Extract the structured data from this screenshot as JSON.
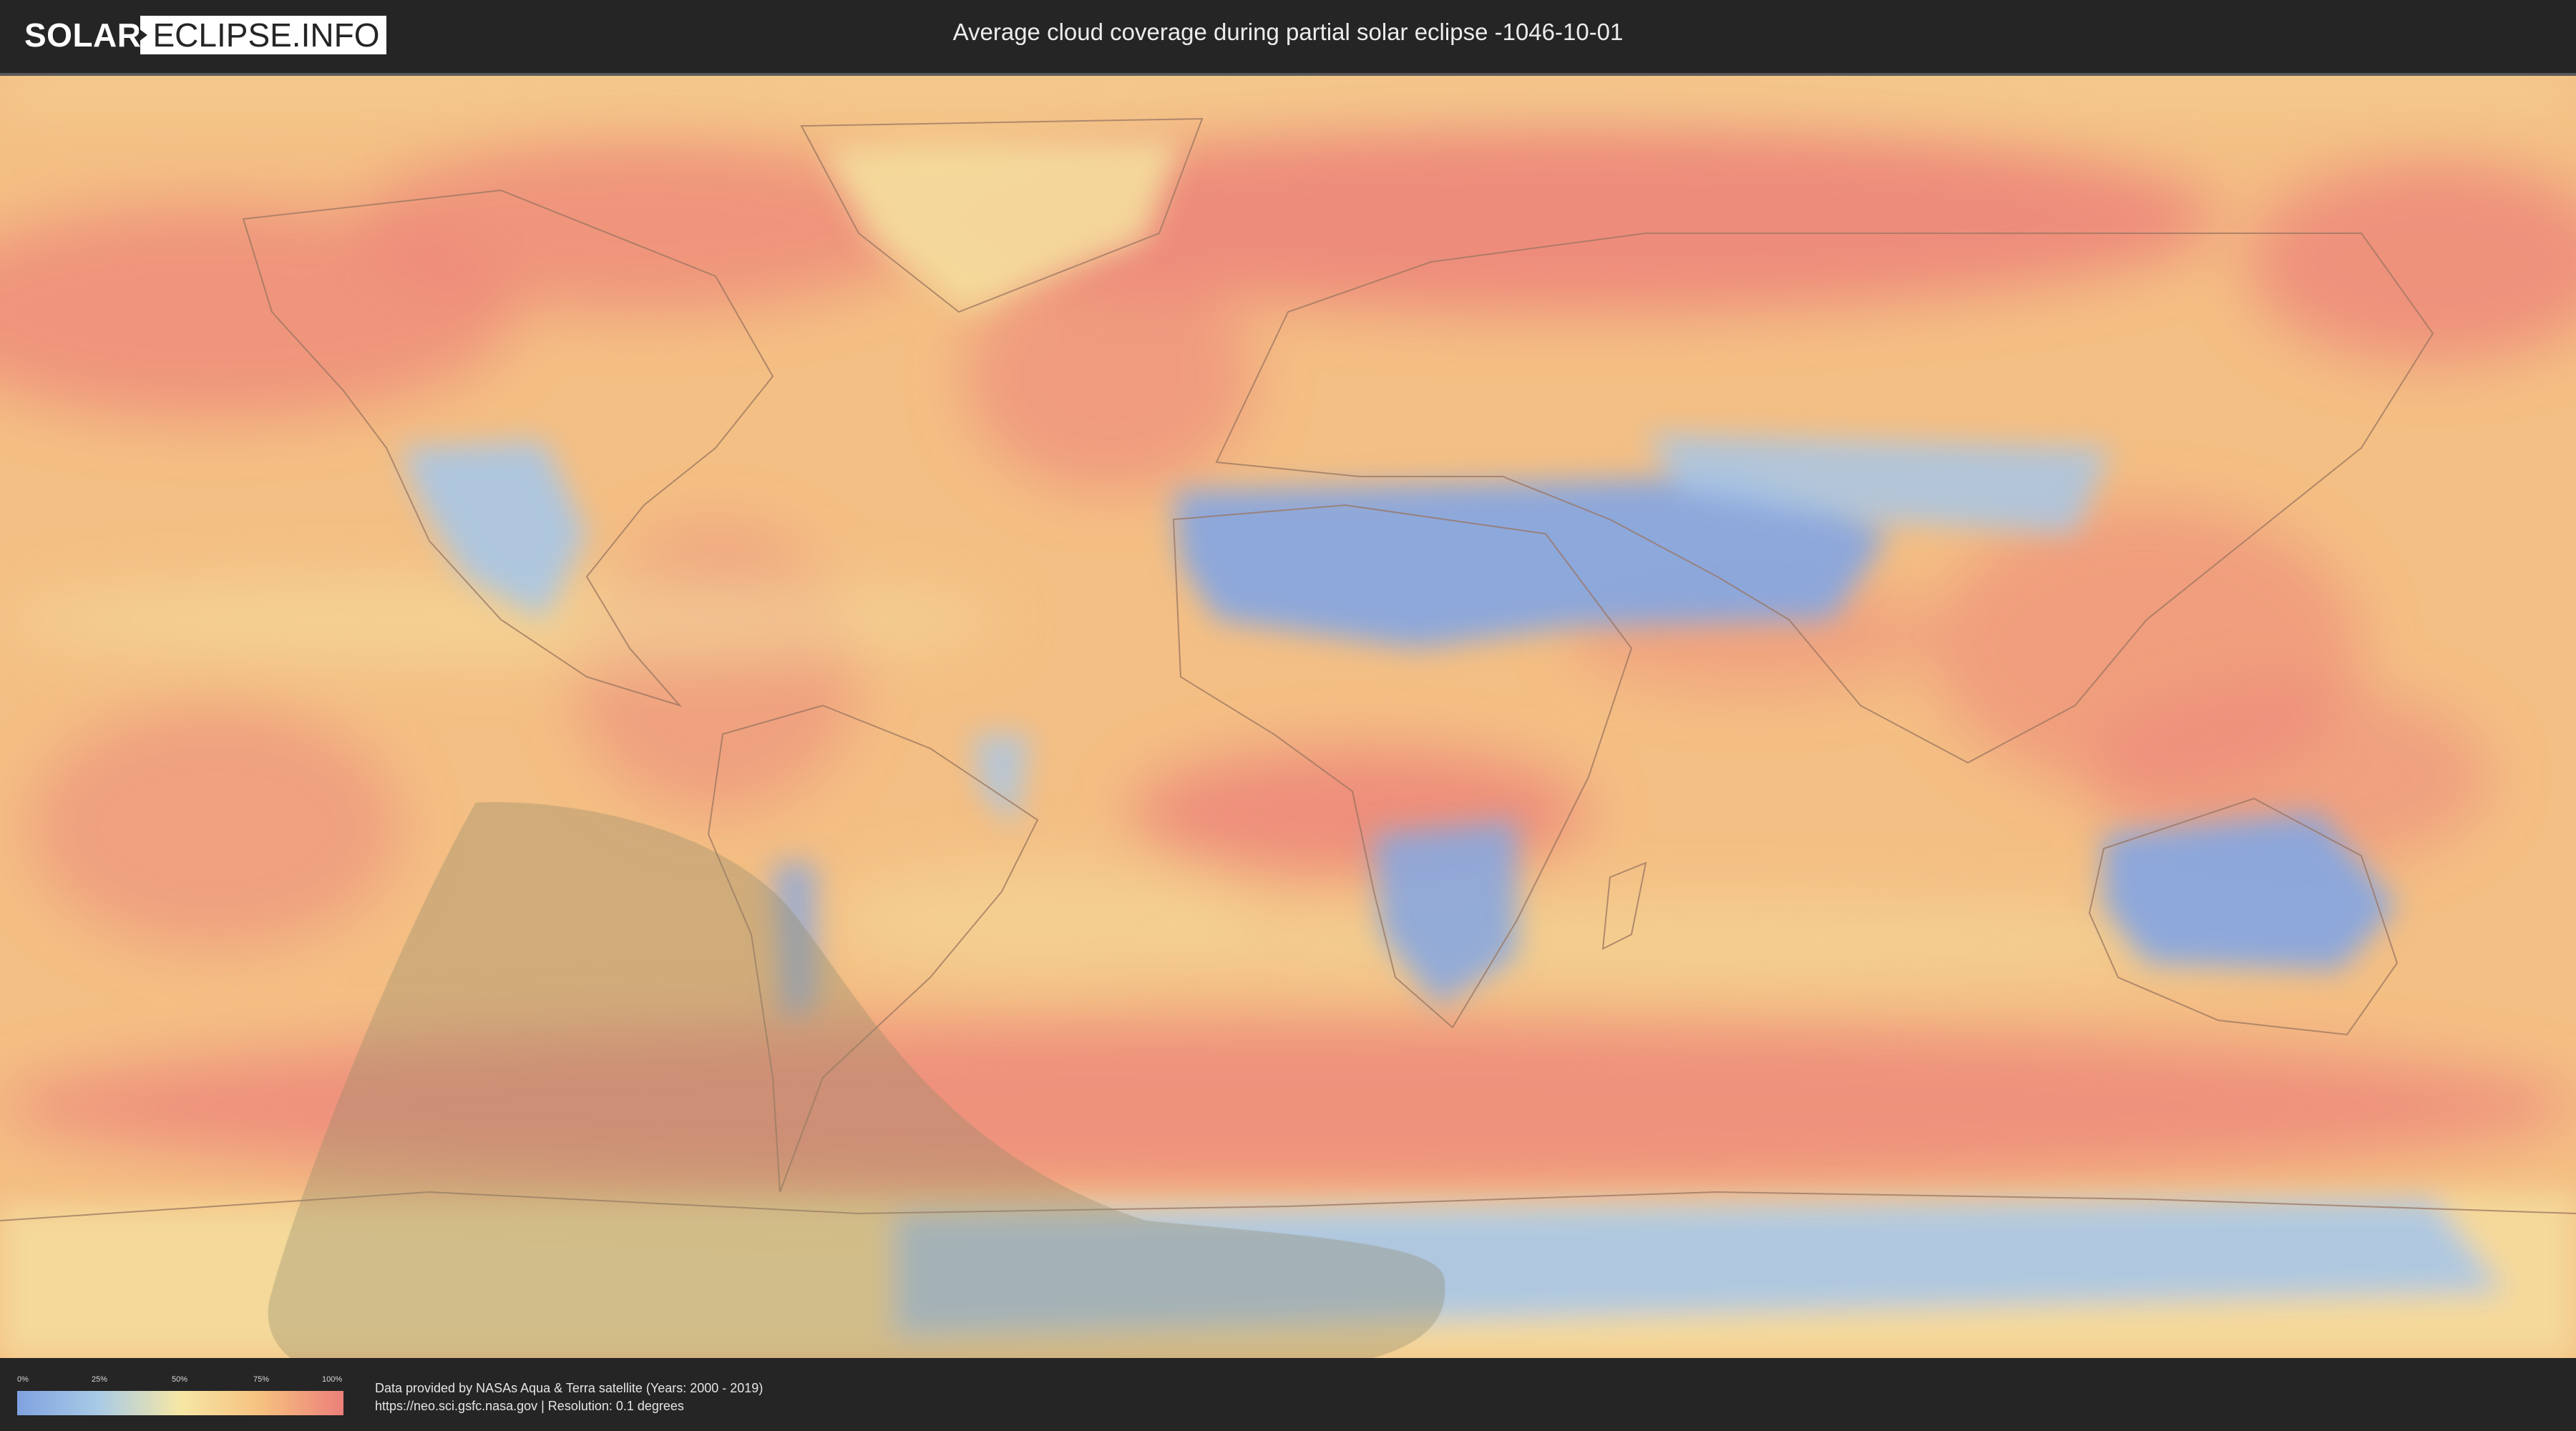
{
  "header": {
    "logo_solar": "SOLAR",
    "logo_eclipse": "ECLIPSE.INFO",
    "title": "Average cloud coverage during partial solar eclipse -1046-10-01"
  },
  "map": {
    "colors": {
      "ocean_base": "#f4bf84",
      "cloudy": "#ec8379",
      "clear": "#88a7df",
      "light_clear": "#a7c7e8",
      "mid": "#f4dd9d",
      "eclipse_shadow": "#8f8a6c"
    }
  },
  "legend": {
    "ticks": [
      "0%",
      "25%",
      "50%",
      "75%",
      "100%"
    ]
  },
  "footer": {
    "credit_line1": "Data provided by NASAs Aqua & Terra satellite (Years: 2000 - 2019)",
    "credit_line2": "https://neo.sci.gsfc.nasa.gov | Resolution: 0.1 degrees"
  }
}
